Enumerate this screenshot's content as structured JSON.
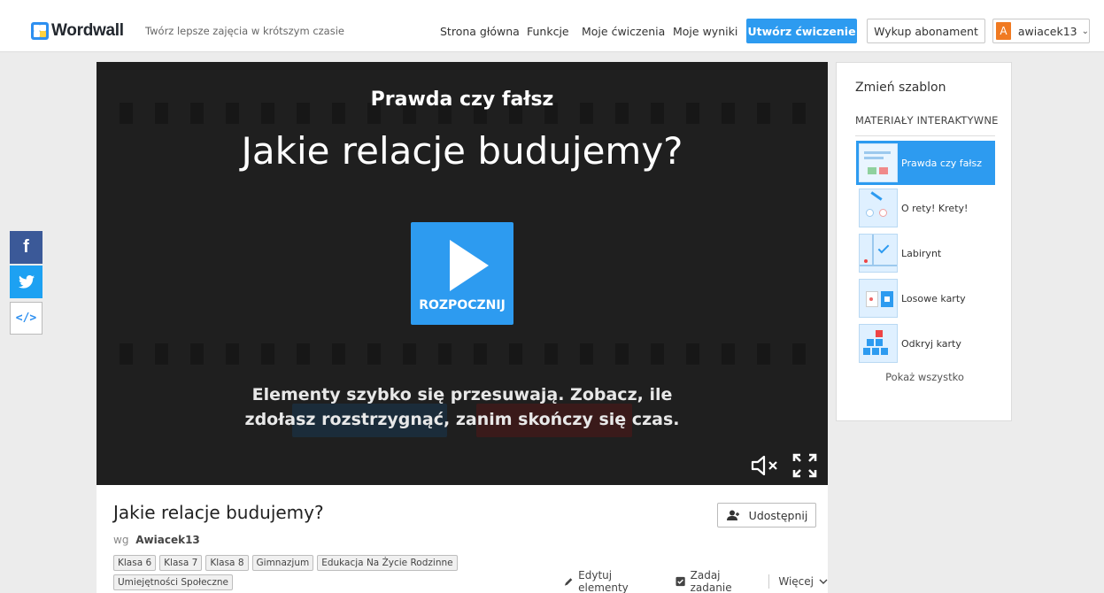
{
  "header": {
    "logo_text": "Wordwall",
    "tagline": "Twórz lepsze zajęcia w krótszym czasie",
    "nav": [
      "Strona główna",
      "Funkcje",
      "Moje ćwiczenia",
      "Moje wyniki"
    ],
    "create_button": "Utwórz ćwiczenie",
    "subscribe_button": "Wykup abonament",
    "user": {
      "initial": "A",
      "name": "awiacek13",
      "caret": "⌄"
    }
  },
  "social": {
    "facebook": "f",
    "embed": "</>"
  },
  "game": {
    "template_name": "Prawda czy fałsz",
    "title": "Jakie relacje budujemy?",
    "start_label": "ROZPOCZNIJ",
    "description_line1": "Elementy szybko się przesuwają. Zobacz, ile",
    "description_line2": "zdołasz rozstrzygnąć, zanim skończy się czas."
  },
  "activity": {
    "title": "Jakie relacje budujemy?",
    "share_label": "Udostępnij",
    "by_prefix": "wg",
    "author": "Awiacek13",
    "tags": [
      "Klasa 6",
      "Klasa 7",
      "Klasa 8",
      "Gimnazjum",
      "Edukacja Na Życie Rodzinne",
      "Umiejętności Społeczne"
    ],
    "edit_label": "Edytuj elementy",
    "assign_label": "Zadaj zadanie",
    "more_label": "Więcej"
  },
  "sidebar": {
    "heading": "Zmień szablon",
    "category": "MATERIAŁY INTERAKTYWNE",
    "templates": [
      {
        "label": "Prawda czy fałsz",
        "active": true
      },
      {
        "label": "O rety! Krety!",
        "active": false
      },
      {
        "label": "Labirynt",
        "active": false
      },
      {
        "label": "Losowe karty",
        "active": false
      },
      {
        "label": "Odkryj karty",
        "active": false
      }
    ],
    "show_all": "Pokaż wszystko"
  },
  "colors": {
    "accent": "#2d9bf0",
    "facebook": "#3b5998",
    "twitter": "#1da1f2",
    "avatar": "#f07a22",
    "game_bg": "#1f1f1f"
  },
  "icons": [
    "wordwall-logo-icon",
    "facebook-icon",
    "twitter-icon",
    "embed-code-icon",
    "play-icon",
    "mute-icon",
    "fullscreen-icon",
    "share-user-icon",
    "pencil-icon",
    "checkbox-icon",
    "chevron-down-icon"
  ]
}
